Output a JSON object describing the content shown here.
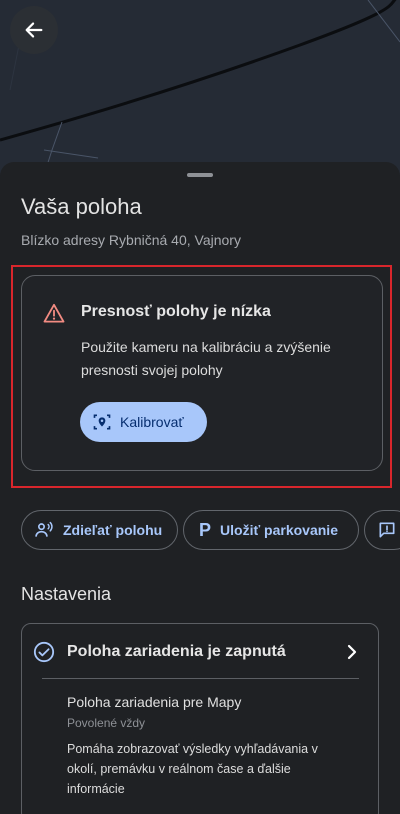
{
  "map": {
    "bg_color": "#252b35"
  },
  "back_button": {
    "icon": "arrow-left-icon"
  },
  "sheet": {
    "title": "Vaša poloha",
    "subtitle": "Blízko adresy Rybničná 40, Vajnory"
  },
  "warning": {
    "icon": "warning-triangle-icon",
    "title": "Presnosť polohy je nízka",
    "text": "Použite kameru na kalibráciu a zvýšenie presnosti svojej polohy",
    "button_label": "Kalibrovať",
    "button_icon": "camera-location-icon",
    "accent": "#a8c7fa",
    "icon_color": "#f28b82"
  },
  "chips": {
    "share_label": "Zdieľať polohu",
    "share_icon": "person-share-icon",
    "park_label": "Uložiť parkovanie",
    "park_glyph": "P",
    "more_icon": "feedback-icon"
  },
  "settings": {
    "section_title": "Nastavenia",
    "main_label": "Poloha zariadenia je zapnutá",
    "main_icon": "check-circle-icon",
    "sub_title": "Poloha zariadenia pre Mapy",
    "sub_status": "Povolené vždy",
    "sub_desc": "Pomáha zobrazovať výsledky vyhľadávania v okolí, premávku v reálnom čase a ďalšie informácie"
  },
  "highlight_color": "#d9262c"
}
